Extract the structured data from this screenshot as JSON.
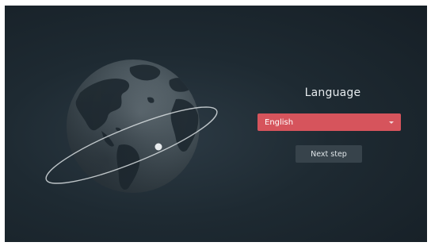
{
  "screen": {
    "colors": {
      "background": "#1c2830",
      "accent": "#d6545c",
      "button": "#37434b",
      "text": "#e6ebee"
    }
  },
  "language": {
    "title": "Language",
    "selected": "English"
  },
  "actions": {
    "next_label": "Next step"
  },
  "graphics": {
    "globe_icon": "earth-globe-with-orbit-icon"
  }
}
